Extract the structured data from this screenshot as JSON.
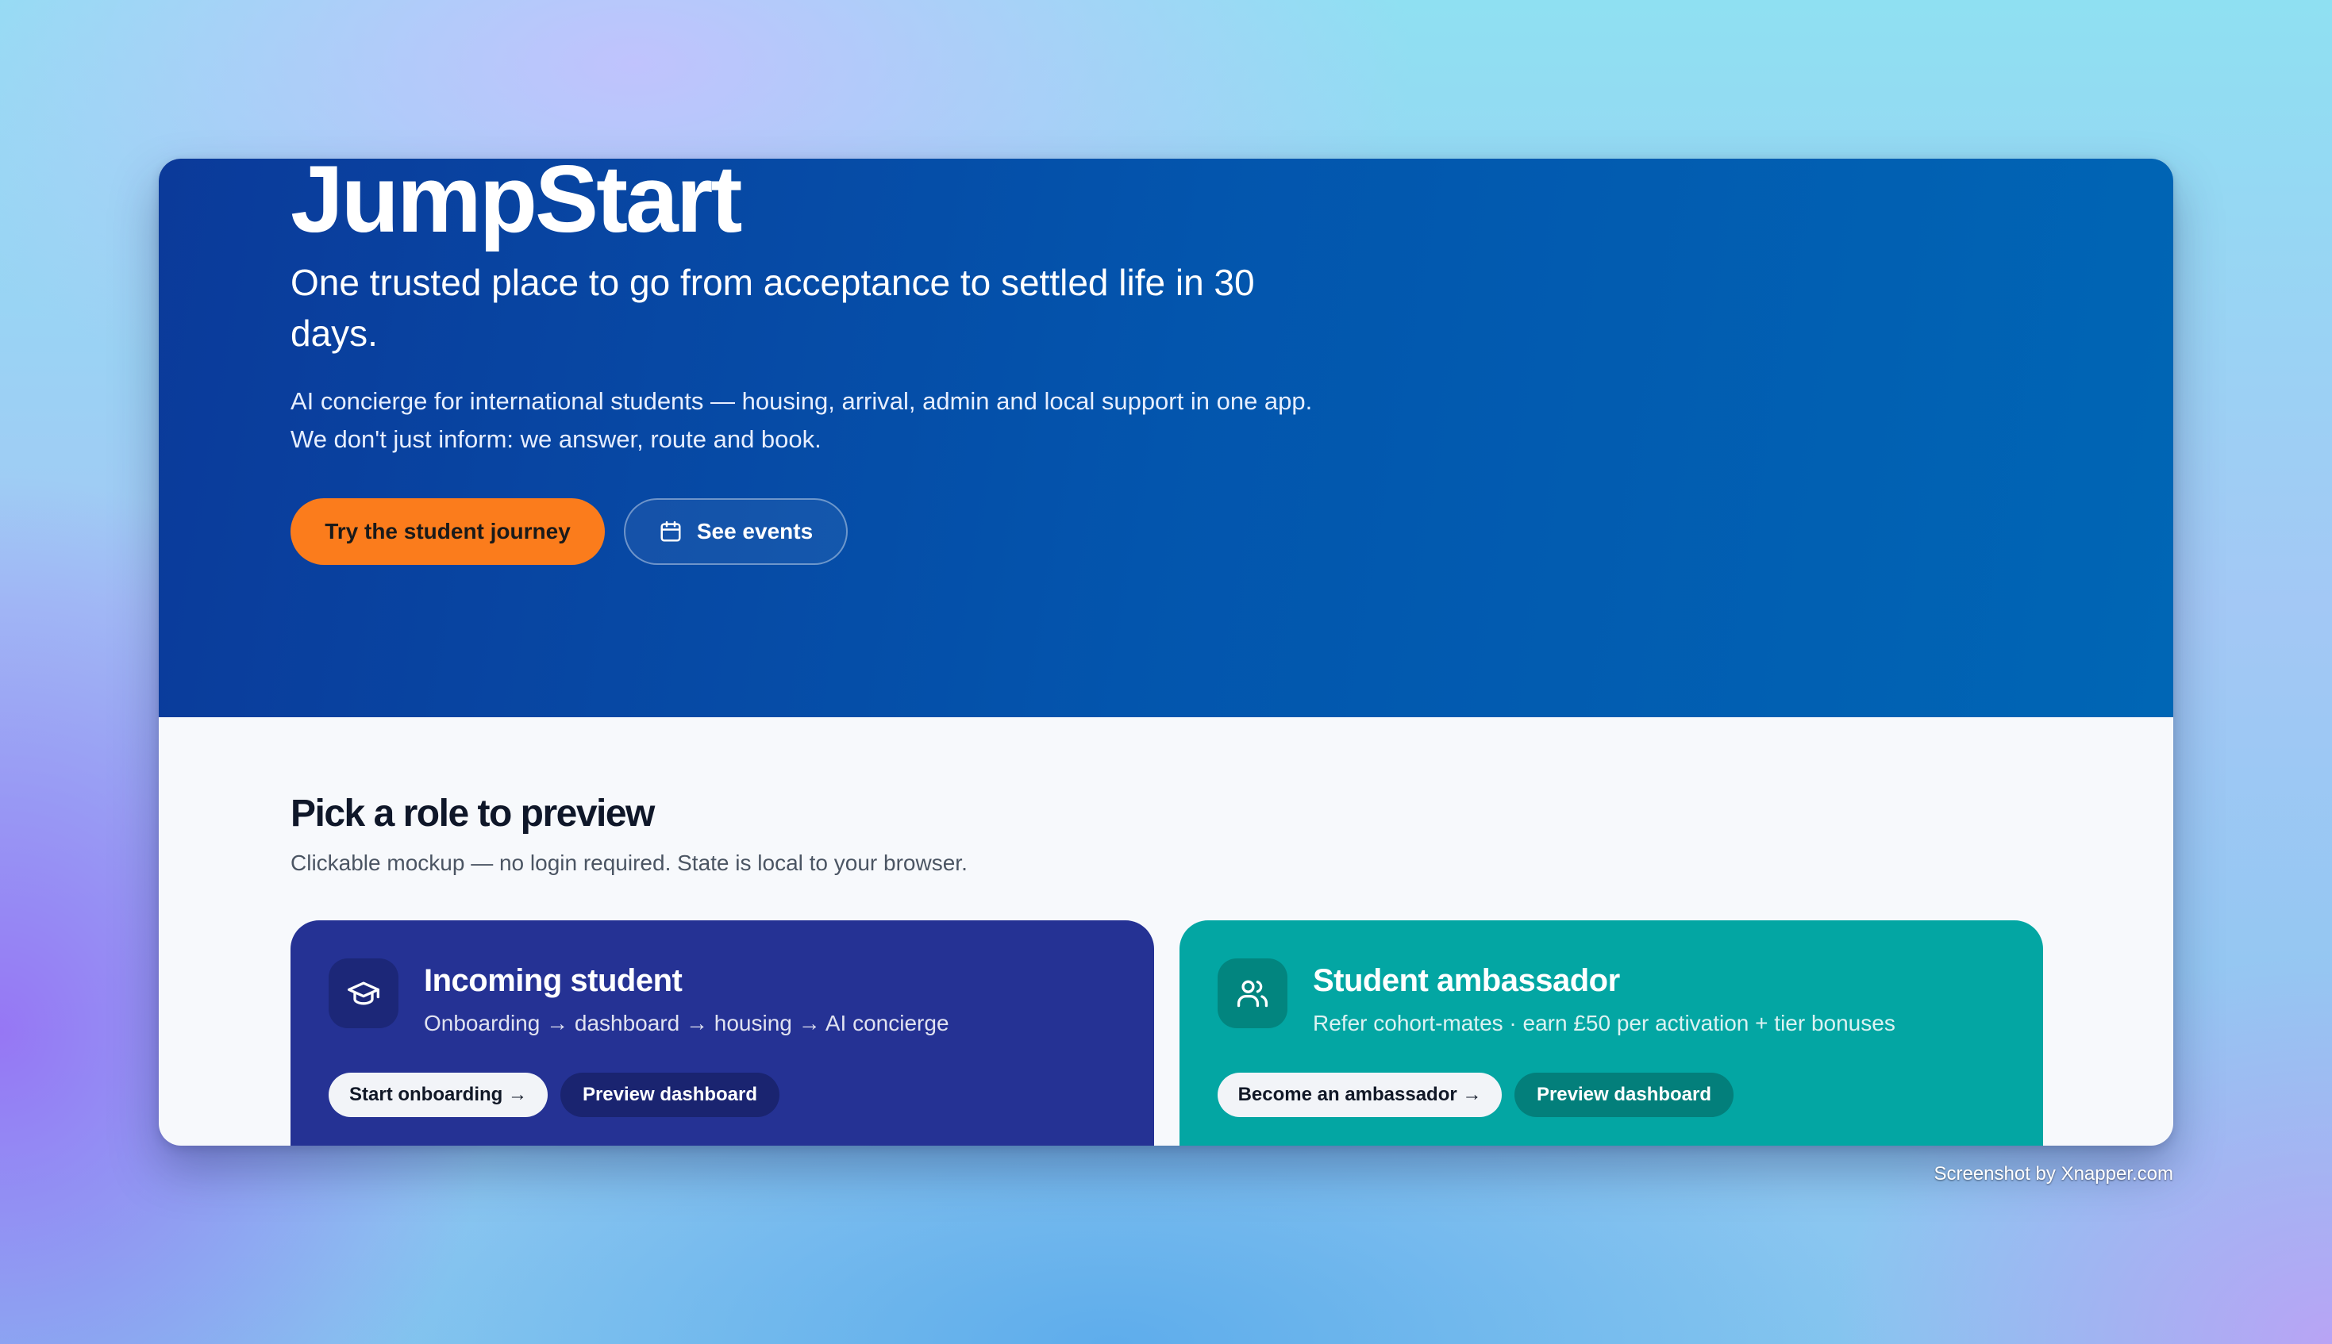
{
  "hero": {
    "title": "JumpStart",
    "subtitle": "One trusted place to go from acceptance to settled life in 30 days.",
    "description": "AI concierge for international students — housing, arrival, admin and local support in one app. We don't just inform: we answer, route and book.",
    "primary_button": "Try the student journey",
    "secondary_button": "See events",
    "secondary_button_icon": "calendar-icon"
  },
  "roles": {
    "title": "Pick a role to preview",
    "subtitle": "Clickable mockup — no login required. State is local to your browser.",
    "cards": [
      {
        "icon": "graduation-cap-icon",
        "title": "Incoming student",
        "description": "Onboarding → dashboard → housing → AI concierge",
        "primary_action": "Start onboarding →",
        "secondary_action": "Preview dashboard",
        "color": "#253294"
      },
      {
        "icon": "users-icon",
        "title": "Student ambassador",
        "description": "Refer cohort-mates · earn £50 per activation + tier bonuses",
        "primary_action": "Become an ambassador →",
        "secondary_action": "Preview dashboard",
        "color": "#03a6a3"
      }
    ]
  },
  "colors": {
    "hero_start": "#0b3a9a",
    "hero_end": "#0066b5",
    "accent_orange": "#fb7c1c"
  },
  "watermark": "Screenshot by Xnapper.com"
}
